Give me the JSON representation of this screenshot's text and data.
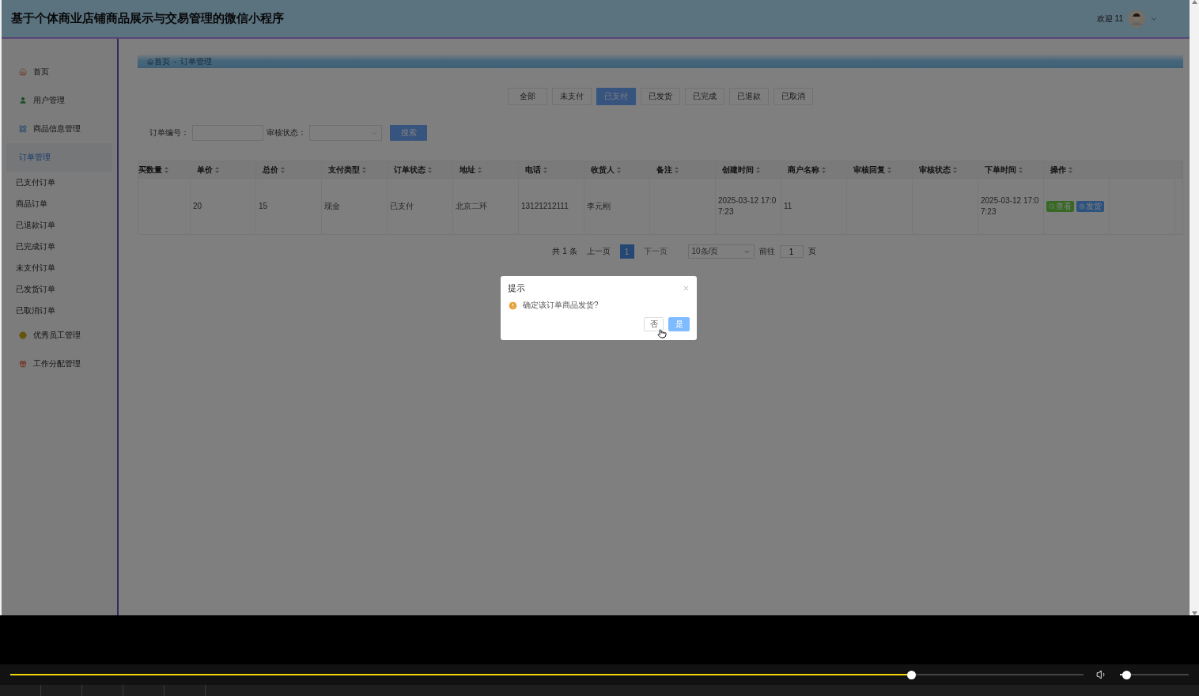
{
  "header": {
    "title": "基于个体商业店铺商品展示与交易管理的微信小程序",
    "welcome": "欢迎 11"
  },
  "sidebar": {
    "items": [
      {
        "label": "首页",
        "selected": false
      },
      {
        "label": "用户管理",
        "selected": false
      },
      {
        "label": "商品信息管理",
        "selected": false
      },
      {
        "label": "订单管理",
        "selected": true,
        "children": [
          {
            "label": "已支付订单",
            "selected": false
          },
          {
            "label": "商品订单",
            "selected": false
          },
          {
            "label": "已退款订单",
            "selected": false
          },
          {
            "label": "已完成订单",
            "selected": false
          },
          {
            "label": "未支付订单",
            "selected": false
          },
          {
            "label": "已发货订单",
            "selected": false
          },
          {
            "label": "已取消订单",
            "selected": false
          }
        ]
      },
      {
        "label": "优秀员工管理",
        "selected": false
      },
      {
        "label": "工作分配管理",
        "selected": false
      }
    ]
  },
  "breadcrumb": {
    "items": [
      "首页",
      "订单管理"
    ],
    "separator": "-"
  },
  "status_tabs": [
    {
      "label": "全部",
      "selected": false
    },
    {
      "label": "未支付",
      "selected": false
    },
    {
      "label": "已支付",
      "selected": true
    },
    {
      "label": "已发货",
      "selected": false
    },
    {
      "label": "已完成",
      "selected": false
    },
    {
      "label": "已退款",
      "selected": false
    },
    {
      "label": "已取消",
      "selected": false
    }
  ],
  "search": {
    "order_label": "订单编号：",
    "status_label": "审核状态：",
    "button": "搜索"
  },
  "table": {
    "columns": [
      "买数量",
      "单价",
      "总价",
      "支付类型",
      "订单状态",
      "地址",
      "电话",
      "收货人",
      "备注",
      "创建时间",
      "商户名称",
      "审核回复",
      "审核状态",
      "下单时间",
      "操作"
    ],
    "rows": [
      {
        "cells": [
          "",
          "20",
          "15",
          "现金",
          "已支付",
          "北京二环",
          "13121212111",
          "李元刚",
          "",
          "2025-03-12 17:07:23",
          "11",
          "",
          "",
          "2025-03-12 17:07:23"
        ],
        "actions": [
          {
            "label": "查看",
            "kind": "view"
          },
          {
            "label": "发货",
            "kind": "ship"
          }
        ]
      }
    ]
  },
  "pagination": {
    "total": "共 1 条",
    "prev": "上一页",
    "pages": [
      {
        "label": "1",
        "selected": true
      }
    ],
    "next": "下一页",
    "page_size": "10条/页",
    "goto": "前往",
    "goto_value": "1",
    "unit": "页"
  },
  "dialog": {
    "title": "提示",
    "message": "确定该订单商品发货?",
    "buttons": [
      {
        "label": "否",
        "kind": "default"
      },
      {
        "label": "是",
        "kind": "primary"
      }
    ]
  },
  "player": {
    "progress": {
      "level": 0.84
    },
    "volume": {
      "level": 0.1
    }
  }
}
